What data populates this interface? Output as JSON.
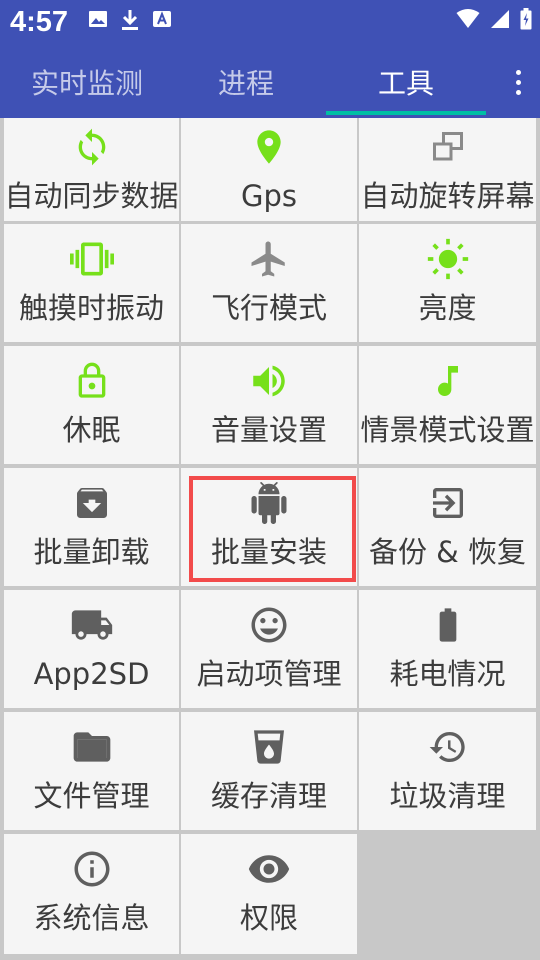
{
  "status_bar": {
    "time": "4:57"
  },
  "tabs": [
    {
      "label": "实时监测"
    },
    {
      "label": "进程"
    },
    {
      "label": "工具"
    }
  ],
  "active_tab": "工具",
  "colors": {
    "primary": "#3f51b5",
    "accent_underline": "#00bfa5",
    "icon_green": "#76e01a",
    "icon_gray": "#5f5f5f",
    "icon_light_gray": "#8a8a8a",
    "highlight_red": "#f24b4b"
  },
  "tools": [
    {
      "label": "自动同步数据",
      "icon": "sync-icon"
    },
    {
      "label": "Gps",
      "icon": "location-pin-icon"
    },
    {
      "label": "自动旋转屏幕",
      "icon": "screen-rotation-icon"
    },
    {
      "label": "触摸时振动",
      "icon": "vibration-icon"
    },
    {
      "label": "飞行模式",
      "icon": "airplane-icon"
    },
    {
      "label": "亮度",
      "icon": "brightness-icon"
    },
    {
      "label": "休眠",
      "icon": "lock-icon"
    },
    {
      "label": "音量设置",
      "icon": "volume-icon"
    },
    {
      "label": "情景模式设置",
      "icon": "music-note-icon"
    },
    {
      "label": "批量卸载",
      "icon": "archive-icon"
    },
    {
      "label": "批量安装",
      "icon": "android-icon"
    },
    {
      "label": "备份 & 恢复",
      "icon": "exit-to-app-icon"
    },
    {
      "label": "App2SD",
      "icon": "truck-icon"
    },
    {
      "label": "启动项管理",
      "icon": "smiley-icon"
    },
    {
      "label": "耗电情况",
      "icon": "battery-icon"
    },
    {
      "label": "文件管理",
      "icon": "folder-icon"
    },
    {
      "label": "缓存清理",
      "icon": "cup-drop-icon"
    },
    {
      "label": "垃圾清理",
      "icon": "history-icon"
    },
    {
      "label": "系统信息",
      "icon": "info-icon"
    },
    {
      "label": "权限",
      "icon": "eye-icon"
    }
  ]
}
